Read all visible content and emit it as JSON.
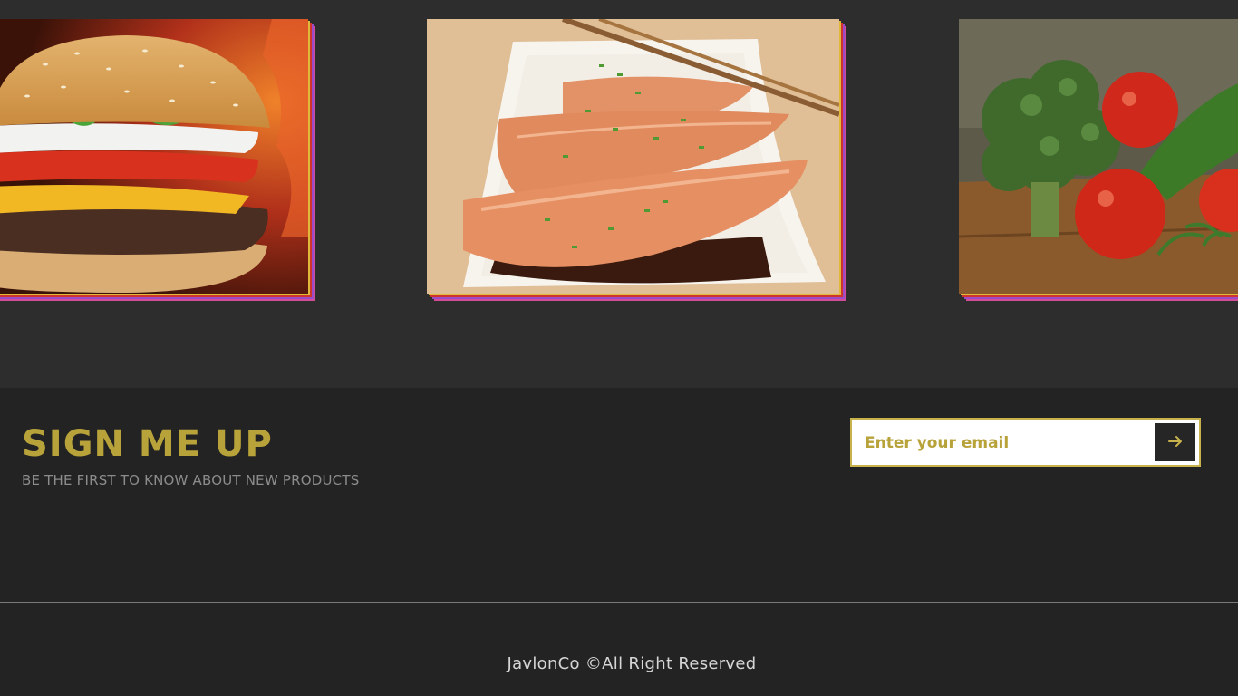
{
  "gallery": {
    "items": [
      {
        "alt": "burger"
      },
      {
        "alt": "salmon"
      },
      {
        "alt": "vegetables"
      }
    ]
  },
  "signup": {
    "title": "SIGN ME UP",
    "subtitle": "BE THE FIRST TO KNOW ABOUT NEW PRODUCTS",
    "email_placeholder": "Enter your email",
    "email_value": "",
    "submit_icon": "arrow-right-icon"
  },
  "footer": {
    "copyright": "JavlonCo ©All Right Reserved"
  },
  "colors": {
    "accent": "#b8a23a",
    "background": "#232323",
    "gallery_background": "#2d2d2d"
  }
}
